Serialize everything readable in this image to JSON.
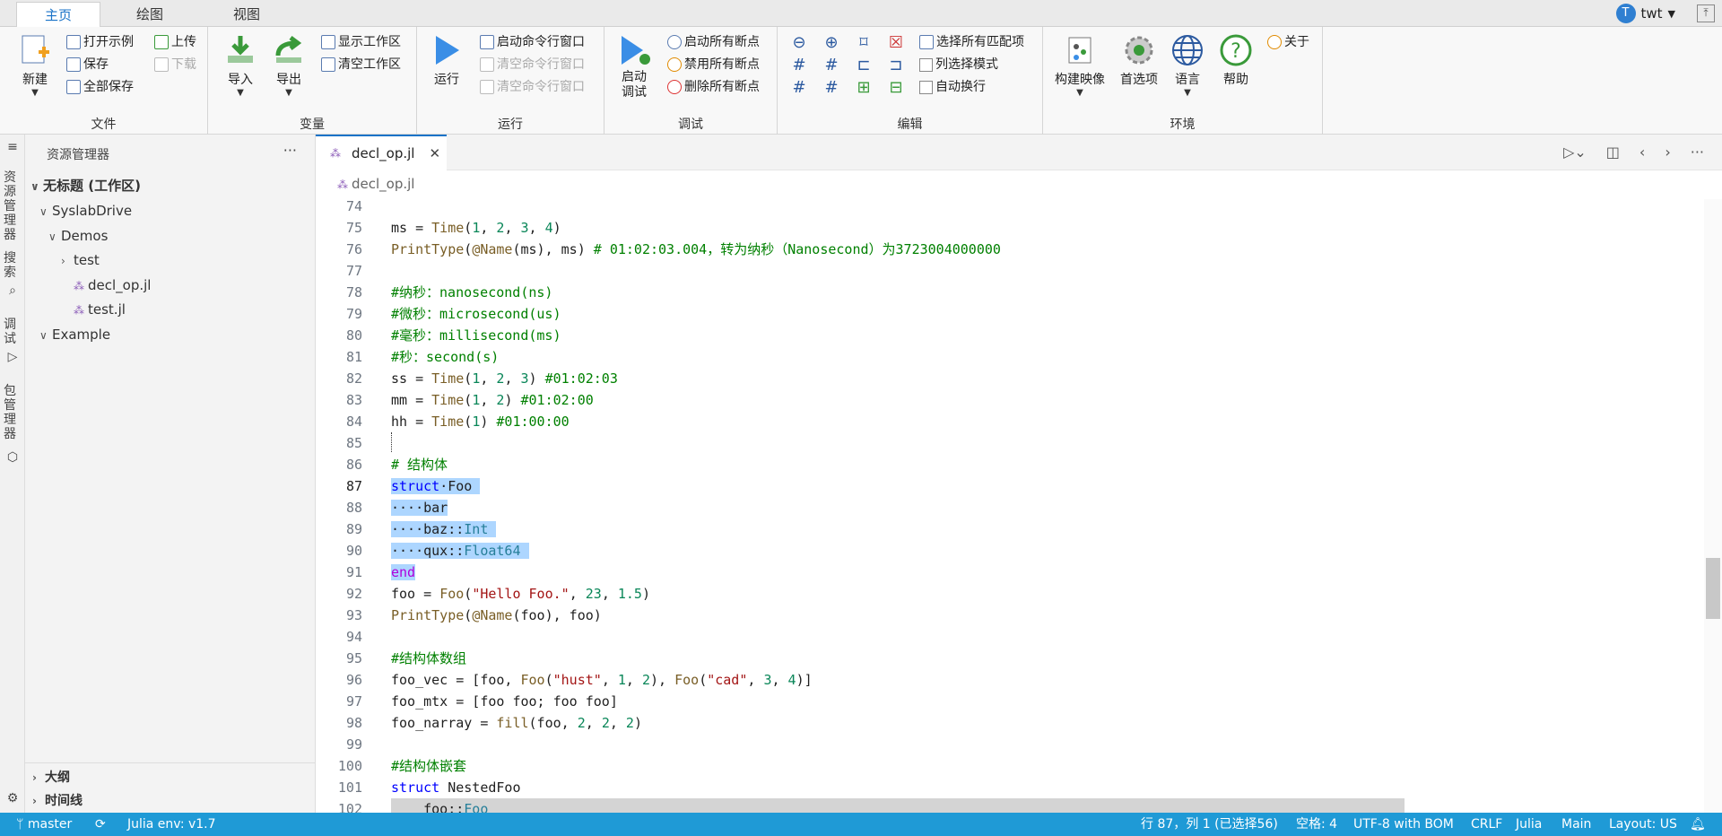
{
  "ribbon_tabs": [
    "主页",
    "绘图",
    "视图"
  ],
  "user": {
    "initial": "T",
    "name": "twt"
  },
  "groups": {
    "file": "文件",
    "variables": "变量",
    "run": "运行",
    "debug": "调试",
    "edit": "编辑",
    "env": "环境"
  },
  "file": {
    "new": "新建",
    "open_example": "打开示例",
    "save": "保存",
    "save_all": "全部保存",
    "upload": "上传",
    "download": "下载"
  },
  "vars": {
    "import": "导入",
    "export": "导出",
    "show_ws": "显示工作区",
    "clear_ws": "清空工作区"
  },
  "run": {
    "run": "运行",
    "start_cmd": "启动命令行窗口",
    "clear_cmd1": "清空命令行窗口",
    "clear_cmd2": "清空命令行窗口"
  },
  "debug": {
    "start": "启动\n调试",
    "enable_bp": "启动所有断点",
    "disable_bp": "禁用所有断点",
    "delete_bp": "删除所有断点"
  },
  "edit": {
    "select_all": "选择所有匹配项",
    "column_mode": "列选择模式",
    "autowrap": "自动换行"
  },
  "env": {
    "build_image": "构建映像",
    "prefs": "首选项",
    "lang": "语言",
    "help": "帮助",
    "about": "关于"
  },
  "activity": {
    "explorer": "资源管理器",
    "search": "搜索",
    "debug": "调试",
    "pkg": "包管理器"
  },
  "explorer": {
    "title": "资源管理器",
    "more": "···",
    "workspace": "无标题 (工作区)",
    "items": [
      "SyslabDrive",
      "Demos",
      "test",
      "decl_op.jl",
      "test.jl",
      "Example"
    ],
    "outline": "大纲",
    "timeline": "时间线"
  },
  "editor": {
    "tab": "decl_op.jl",
    "breadcrumb": "decl_op.jl"
  },
  "code": {
    "line_numbers": [
      "74",
      "75",
      "76",
      "77",
      "78",
      "79",
      "80",
      "81",
      "82",
      "83",
      "84",
      "85",
      "86",
      "87",
      "88",
      "89",
      "90",
      "91",
      "92",
      "93",
      "94",
      "95",
      "96",
      "97",
      "98",
      "99",
      "100",
      "101",
      "102"
    ],
    "l75": [
      "ms = ",
      "Time",
      "(",
      "1",
      ", ",
      "2",
      ", ",
      "3",
      ", ",
      "4",
      ")"
    ],
    "l76a": "PrintType",
    "l76b": "(",
    "l76c": "@Name",
    "l76d": "(ms), ms) ",
    "l76e": "# 01:02:03.004，转为纳秒（Nanosecond）为3723004000000",
    "l78": "#纳秒：nanosecond(ns)",
    "l79": "#微秒：microsecond(us)",
    "l80": "#毫秒：millisecond(ms)",
    "l81": "#秒：second(s)",
    "l82": [
      "ss = ",
      "Time",
      "(",
      "1",
      ", ",
      "2",
      ", ",
      "3",
      ") ",
      "#01:02:03"
    ],
    "l83": [
      "mm = ",
      "Time",
      "(",
      "1",
      ", ",
      "2",
      ") ",
      "#01:02:00"
    ],
    "l84": [
      "hh = ",
      "Time",
      "(",
      "1",
      ") ",
      "#01:00:00"
    ],
    "l86": "# 结构体",
    "l87": [
      "struct",
      "·Foo"
    ],
    "l88": "····bar",
    "l89a": "····baz::",
    "l89b": "Int",
    "l90a": "····qux::",
    "l90b": "Float64",
    "l91": "end",
    "l92": [
      "foo = ",
      "Foo",
      "(",
      "\"Hello Foo.\"",
      ", ",
      "23",
      ", ",
      "1.5",
      ")"
    ],
    "l93": [
      "PrintType",
      "(",
      "@Name",
      "(foo), foo)"
    ],
    "l95": "#结构体数组",
    "l96": [
      "foo_vec = [foo, ",
      "Foo",
      "(",
      "\"hust\"",
      ", ",
      "1",
      ", ",
      "2",
      "), ",
      "Foo",
      "(",
      "\"cad\"",
      ", ",
      "3",
      ", ",
      "4",
      ")]"
    ],
    "l97": "foo_mtx = [foo foo; foo foo]",
    "l98": [
      "foo_narray = ",
      "fill",
      "(foo, ",
      "2",
      ", ",
      "2",
      ", ",
      "2",
      ")"
    ],
    "l100": "#结构体嵌套",
    "l101": [
      "struct",
      " NestedFoo"
    ],
    "l102": [
      "    foo::",
      "Foo"
    ]
  },
  "status": {
    "branch": "master",
    "env": "Julia env: v1.7",
    "pos": "行 87，列 1 (已选择56)",
    "spaces": "空格: 4",
    "enc": "UTF-8 with BOM",
    "eol": "CRLF",
    "lang": "Julia",
    "main": "Main",
    "layout": "Layout: US"
  }
}
